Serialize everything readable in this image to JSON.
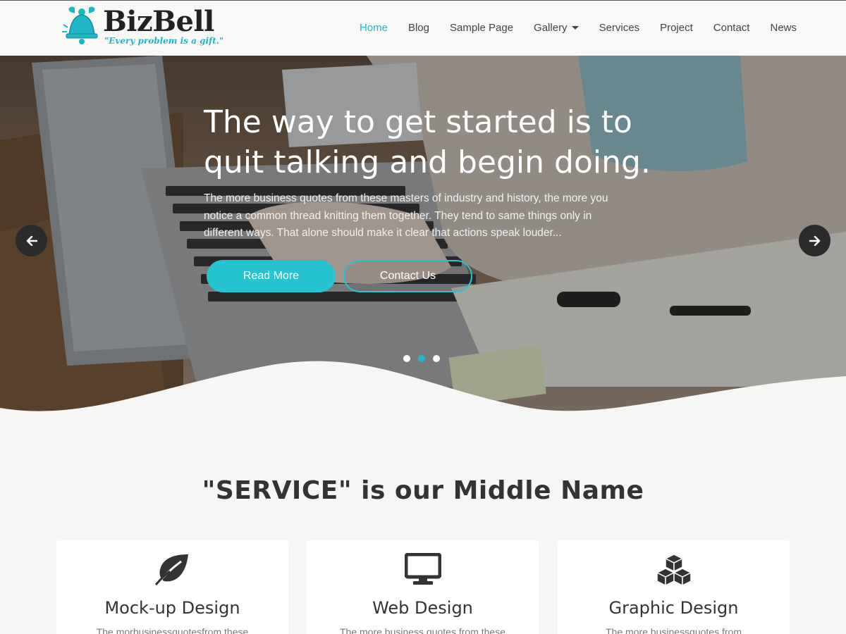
{
  "brand": {
    "name": "BizBell",
    "tagline": "\"Every problem is a gift.\"",
    "accent": "#22b8cd"
  },
  "nav": {
    "items": [
      {
        "label": "Home",
        "active": true
      },
      {
        "label": "Blog"
      },
      {
        "label": "Sample Page"
      },
      {
        "label": "Gallery",
        "dropdown": true
      },
      {
        "label": "Services"
      },
      {
        "label": "Project"
      },
      {
        "label": "Contact"
      },
      {
        "label": "News"
      }
    ]
  },
  "hero": {
    "title_line1": "The way to get started is to",
    "title_line2": "quit talking and begin doing.",
    "text": "The more business quotes from these masters of industry and history, the more you notice a common thread knitting them together. They tend to same things only in different ways. That alone should make it clear that actions speak louder...",
    "read_more": "Read More",
    "contact_us": "Contact Us",
    "prev_icon": "arrow-left-icon",
    "next_icon": "arrow-right-icon",
    "slides": 3,
    "active_slide": 2
  },
  "services": {
    "title": "\"SERVICE\" is our Middle Name",
    "cards": [
      {
        "icon": "leaf-icon",
        "title": "Mock-up Design",
        "text": "The morbusinessquotesfrom these"
      },
      {
        "icon": "monitor-icon",
        "title": "Web Design",
        "text": "The more business quotes from these"
      },
      {
        "icon": "cubes-icon",
        "title": "Graphic Design",
        "text": "The more businessquotes from"
      }
    ]
  }
}
